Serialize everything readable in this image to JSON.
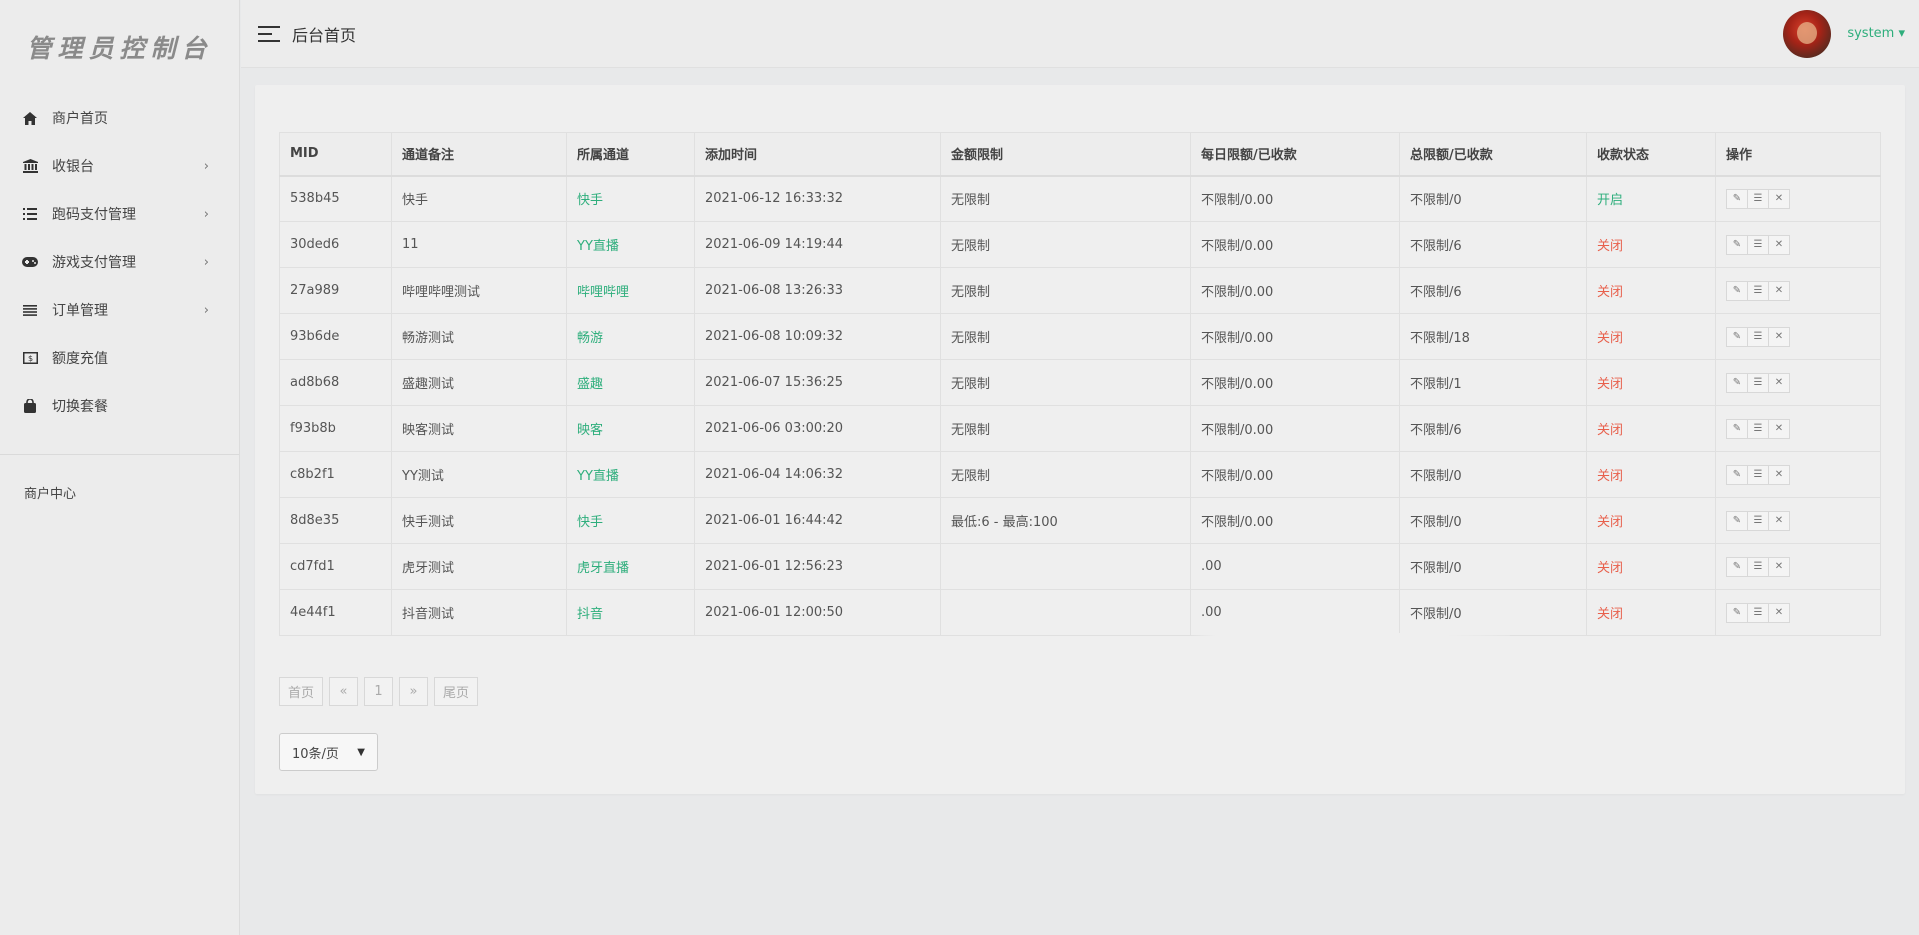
{
  "sidebar": {
    "logo": "管理员控制台",
    "items": [
      {
        "label": "商户首页",
        "icon": "home-icon",
        "chevron": false
      },
      {
        "label": "收银台",
        "icon": "bank-icon",
        "chevron": true
      },
      {
        "label": "跑码支付管理",
        "icon": "list-icon",
        "chevron": true
      },
      {
        "label": "游戏支付管理",
        "icon": "gamepad-icon",
        "chevron": true
      },
      {
        "label": "订单管理",
        "icon": "lines-icon",
        "chevron": true
      },
      {
        "label": "额度充值",
        "icon": "money-icon",
        "chevron": false
      },
      {
        "label": "切换套餐",
        "icon": "bag-icon",
        "chevron": false
      }
    ],
    "section_label": "商户中心"
  },
  "header": {
    "breadcrumb": "后台首页",
    "username": "system"
  },
  "table": {
    "columns": [
      "MID",
      "通道备注",
      "所属通道",
      "添加时间",
      "金额限制",
      "每日限额/已收款",
      "总限额/已收款",
      "收款状态",
      "操作"
    ],
    "rows": [
      {
        "mid": "538b45",
        "remark": "快手",
        "channel": "快手",
        "time": "2021-06-12 16:33:32",
        "amount": "无限制",
        "daily": "不限制/0.00",
        "total": "不限制/0",
        "status": "开启",
        "status_on": true
      },
      {
        "mid": "30ded6",
        "remark": "11",
        "channel": "YY直播",
        "time": "2021-06-09 14:19:44",
        "amount": "无限制",
        "daily": "不限制/0.00",
        "total": "不限制/6",
        "status": "关闭",
        "status_on": false
      },
      {
        "mid": "27a989",
        "remark": "哔哩哔哩测试",
        "channel": "哔哩哔哩",
        "time": "2021-06-08 13:26:33",
        "amount": "无限制",
        "daily": "不限制/0.00",
        "total": "不限制/6",
        "status": "关闭",
        "status_on": false
      },
      {
        "mid": "93b6de",
        "remark": "畅游测试",
        "channel": "畅游",
        "time": "2021-06-08 10:09:32",
        "amount": "无限制",
        "daily": "不限制/0.00",
        "total": "不限制/18",
        "status": "关闭",
        "status_on": false
      },
      {
        "mid": "ad8b68",
        "remark": "盛趣测试",
        "channel": "盛趣",
        "time": "2021-06-07 15:36:25",
        "amount": "无限制",
        "daily": "不限制/0.00",
        "total": "不限制/1",
        "status": "关闭",
        "status_on": false
      },
      {
        "mid": "f93b8b",
        "remark": "映客测试",
        "channel": "映客",
        "time": "2021-06-06 03:00:20",
        "amount": "无限制",
        "daily": "不限制/0.00",
        "total": "不限制/6",
        "status": "关闭",
        "status_on": false
      },
      {
        "mid": "c8b2f1",
        "remark": "YY测试",
        "channel": "YY直播",
        "time": "2021-06-04 14:06:32",
        "amount": "无限制",
        "daily": "不限制/0.00",
        "total": "不限制/0",
        "status": "关闭",
        "status_on": false
      },
      {
        "mid": "8d8e35",
        "remark": "快手测试",
        "channel": "快手",
        "time": "2021-06-01 16:44:42",
        "amount": "最低:6 - 最高:100",
        "daily": "不限制/0.00",
        "total": "不限制/0",
        "status": "关闭",
        "status_on": false
      },
      {
        "mid": "cd7fd1",
        "remark": "虎牙测试",
        "channel": "虎牙直播",
        "time": "2021-06-01 12:56:23",
        "amount": "",
        "daily": ".00",
        "total": "不限制/0",
        "status": "关闭",
        "status_on": false
      },
      {
        "mid": "4e44f1",
        "remark": "抖音测试",
        "channel": "抖音",
        "time": "2021-06-01 12:00:50",
        "amount": "",
        "daily": ".00",
        "total": "不限制/0",
        "status": "关闭",
        "status_on": false
      }
    ],
    "op_icons": [
      "edit-icon",
      "detail-icon",
      "delete-icon"
    ]
  },
  "pagination": {
    "first": "首页",
    "prev": "«",
    "page": "1",
    "next": "»",
    "last": "尾页",
    "page_size": "10条/页"
  },
  "colors": {
    "accent_green": "#2eae7c",
    "status_red": "#e8604c"
  }
}
